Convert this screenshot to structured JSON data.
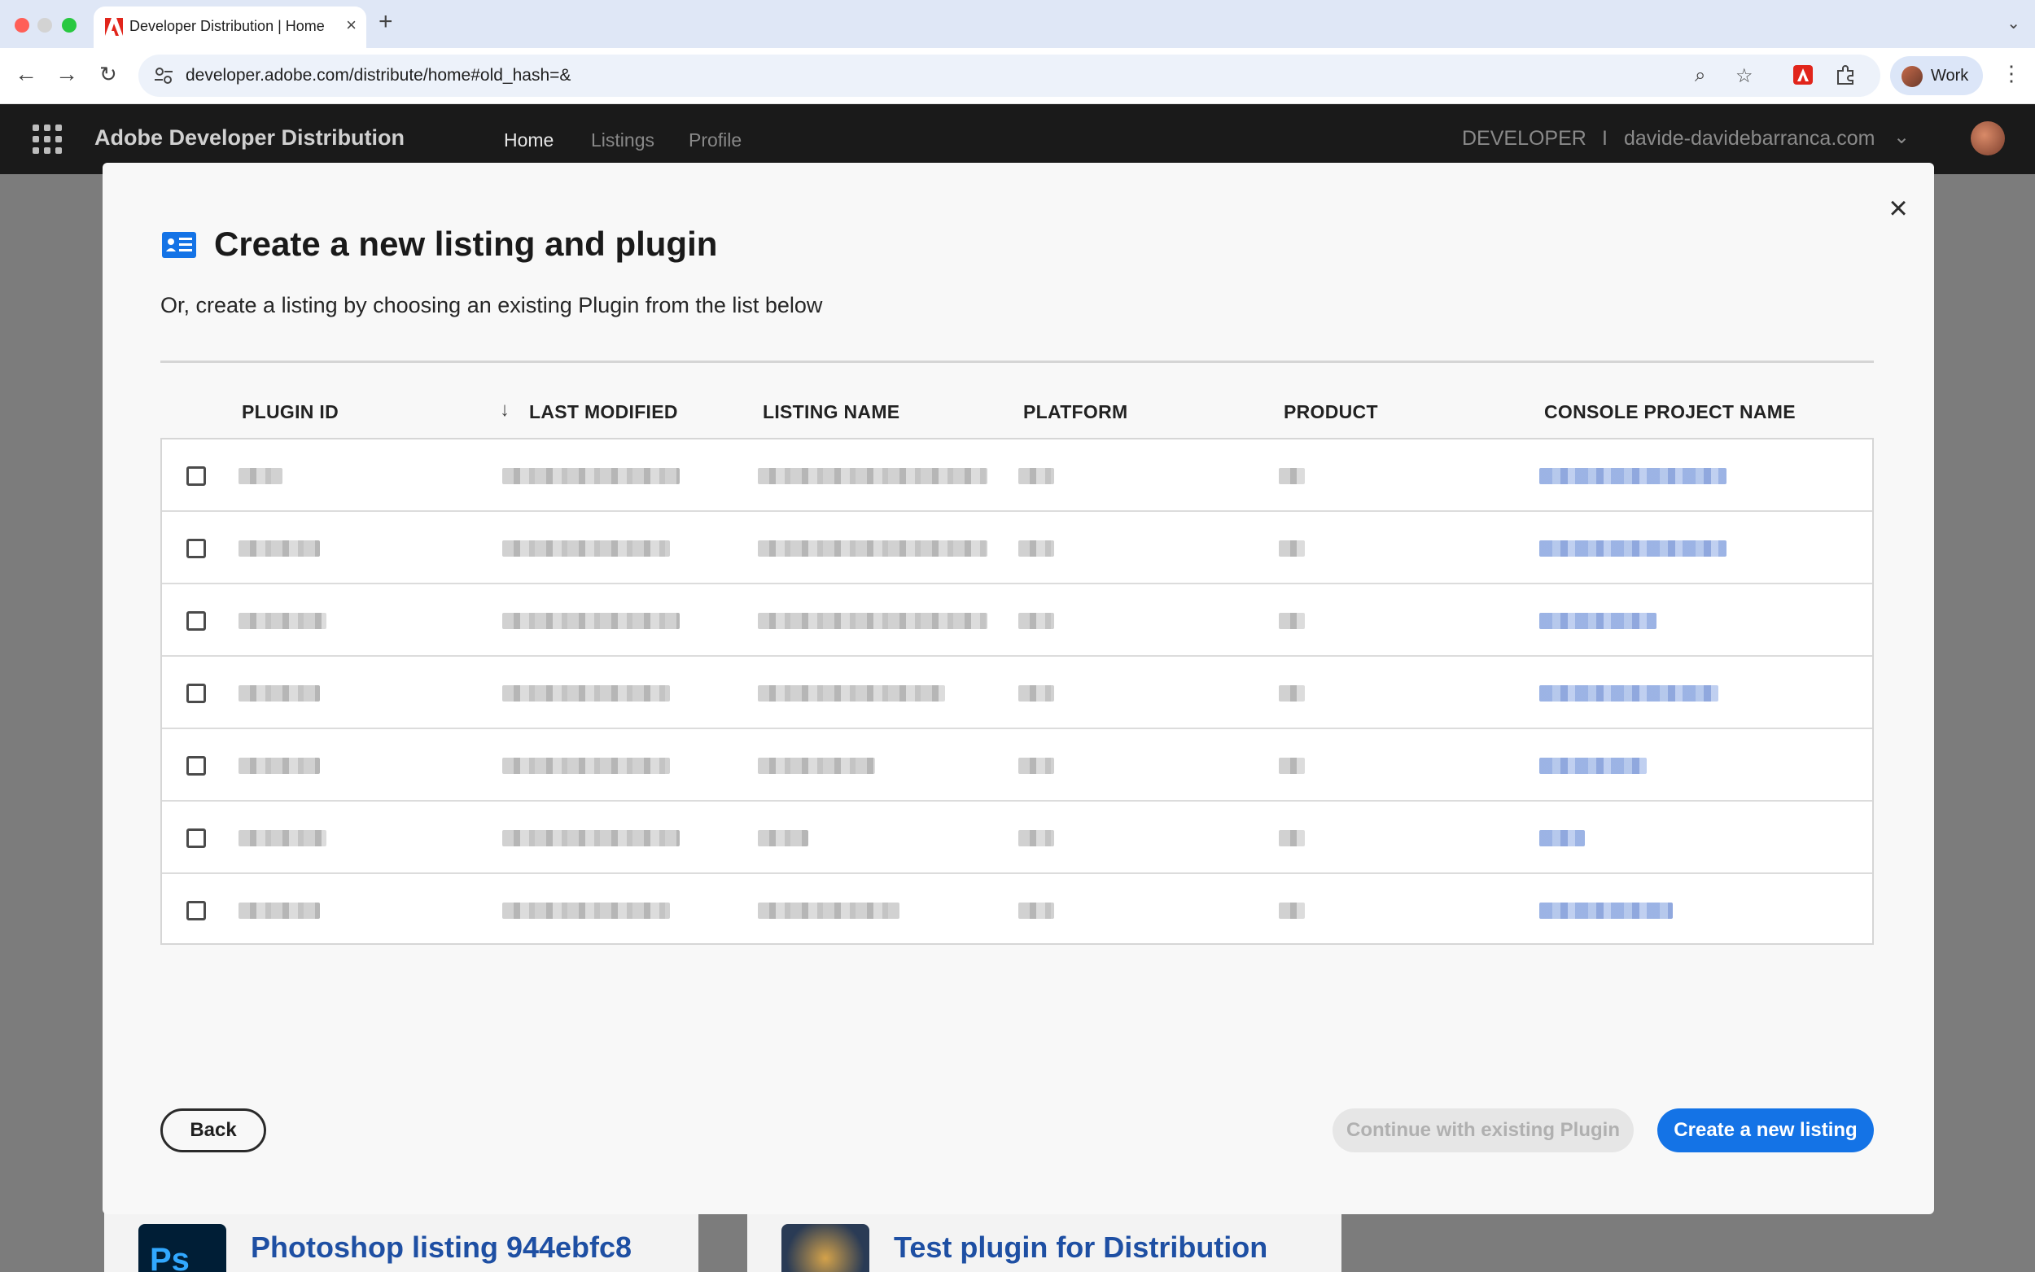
{
  "browser": {
    "tab_title": "Developer Distribution | Home",
    "url": "developer.adobe.com/distribute/home#old_hash=&",
    "profile_label": "Work"
  },
  "appbar": {
    "brand": "Adobe Developer Distribution",
    "nav": [
      "Home",
      "Listings",
      "Profile"
    ],
    "role": "DEVELOPER",
    "separator": "I",
    "account": "davide-davidebarranca.com"
  },
  "background_cards": [
    {
      "title": "Photoshop listing 944ebfc8",
      "thumb_label": "Ps"
    },
    {
      "title": "Test plugin for Distribution"
    }
  ],
  "modal": {
    "title": "Create a new listing and plugin",
    "subtitle": "Or, create a listing by choosing an existing Plugin from the list below",
    "columns": [
      "PLUGIN ID",
      "LAST MODIFIED",
      "LISTING NAME",
      "PLATFORM",
      "PRODUCT",
      "CONSOLE PROJECT NAME"
    ],
    "sorted_column": "LAST MODIFIED",
    "rows": [
      {
        "plugin_id": "",
        "last_modified": "",
        "listing_name": "",
        "platform": "",
        "product": "",
        "console_project": ""
      },
      {
        "plugin_id": "",
        "last_modified": "",
        "listing_name": "",
        "platform": "",
        "product": "",
        "console_project": ""
      },
      {
        "plugin_id": "",
        "last_modified": "",
        "listing_name": "",
        "platform": "",
        "product": "",
        "console_project": ""
      },
      {
        "plugin_id": "",
        "last_modified": "",
        "listing_name": "",
        "platform": "",
        "product": "",
        "console_project": ""
      },
      {
        "plugin_id": "",
        "last_modified": "",
        "listing_name": "",
        "platform": "",
        "product": "",
        "console_project": ""
      },
      {
        "plugin_id": "",
        "last_modified": "",
        "listing_name": "",
        "platform": "",
        "product": "",
        "console_project": ""
      },
      {
        "plugin_id": "",
        "last_modified": "",
        "listing_name": "",
        "platform": "",
        "product": "",
        "console_project": ""
      }
    ],
    "back_label": "Back",
    "continue_label": "Continue with existing Plugin",
    "create_label": "Create a new listing"
  },
  "colors": {
    "accent": "#1473e6",
    "appbar": "#1a1a1a",
    "link": "#1e4fa3",
    "tabbar": "#dfe7f6"
  }
}
